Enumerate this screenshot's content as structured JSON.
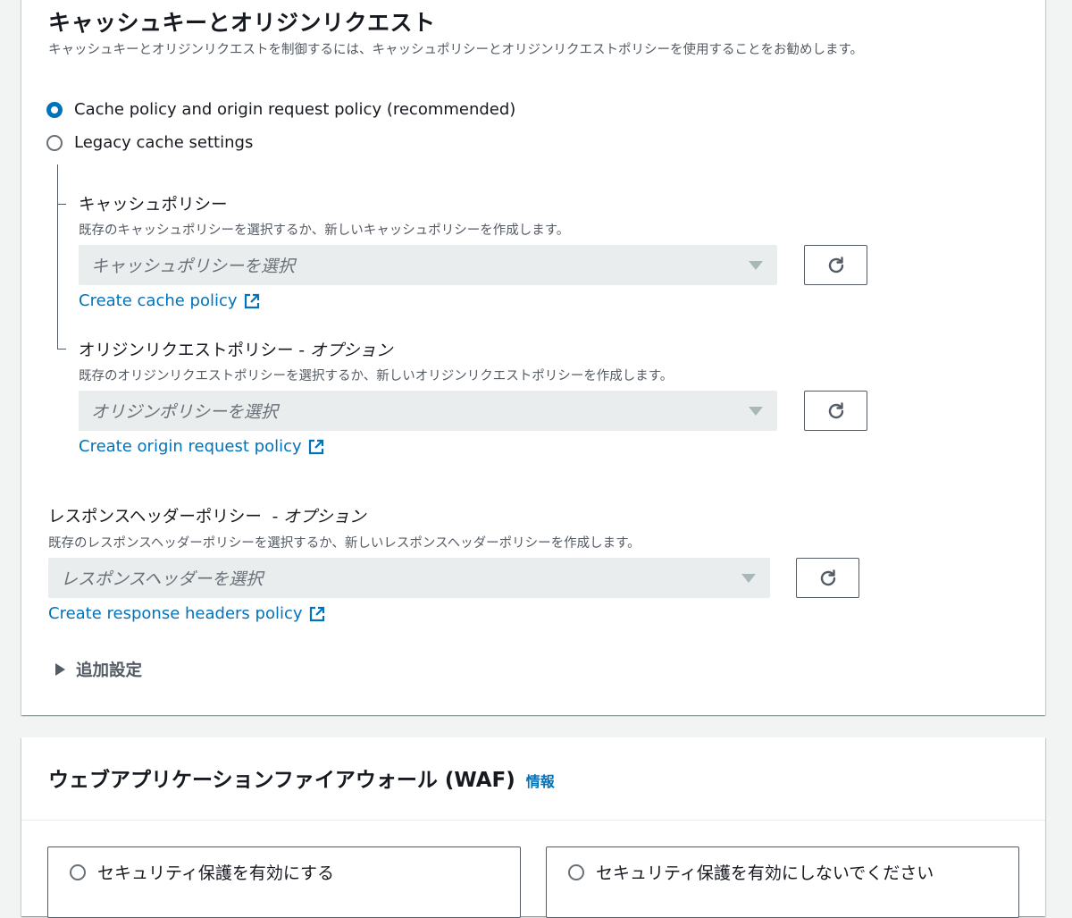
{
  "cache_section": {
    "title": "キャッシュキーとオリジンリクエスト",
    "description": "キャッシュキーとオリジンリクエストを制御するには、キャッシュポリシーとオリジンリクエストポリシーを使用することをお勧めします。",
    "options": [
      {
        "label": "Cache policy and origin request policy (recommended)",
        "selected": true
      },
      {
        "label": "Legacy cache settings",
        "selected": false
      }
    ],
    "cache_policy": {
      "label": "キャッシュポリシー",
      "description": "既存のキャッシュポリシーを選択するか、新しいキャッシュポリシーを作成します。",
      "placeholder": "キャッシュポリシーを選択",
      "create_link": "Create cache policy"
    },
    "origin_policy": {
      "label": "オリジンリクエストポリシー - ",
      "label_optional": "オプション",
      "description": "既存のオリジンリクエストポリシーを選択するか、新しいオリジンリクエストポリシーを作成します。",
      "placeholder": "オリジンポリシーを選択",
      "create_link": "Create origin request policy"
    },
    "response_headers": {
      "label": "レスポンスヘッダーポリシー  - ",
      "label_optional": "オプション",
      "description": "既存のレスポンスヘッダーポリシーを選択するか、新しいレスポンスヘッダーポリシーを作成します。",
      "placeholder": "レスポンスヘッダーを選択",
      "create_link": "Create response headers policy"
    },
    "additional_settings": "追加設定"
  },
  "waf_section": {
    "title": "ウェブアプリケーションファイアウォール (WAF)",
    "info_link": "情報",
    "tiles": [
      {
        "label": "セキュリティ保護を有効にする"
      },
      {
        "label": "セキュリティ保護を有効にしないでください"
      }
    ]
  },
  "colors": {
    "link": "#0073bb",
    "text": "#16191f",
    "muted": "#545b64",
    "select_bg": "#eaeded"
  },
  "icons": {
    "refresh": "refresh-icon",
    "external": "external-link-icon",
    "caret": "caret-down-icon",
    "expand": "caret-right-icon"
  }
}
